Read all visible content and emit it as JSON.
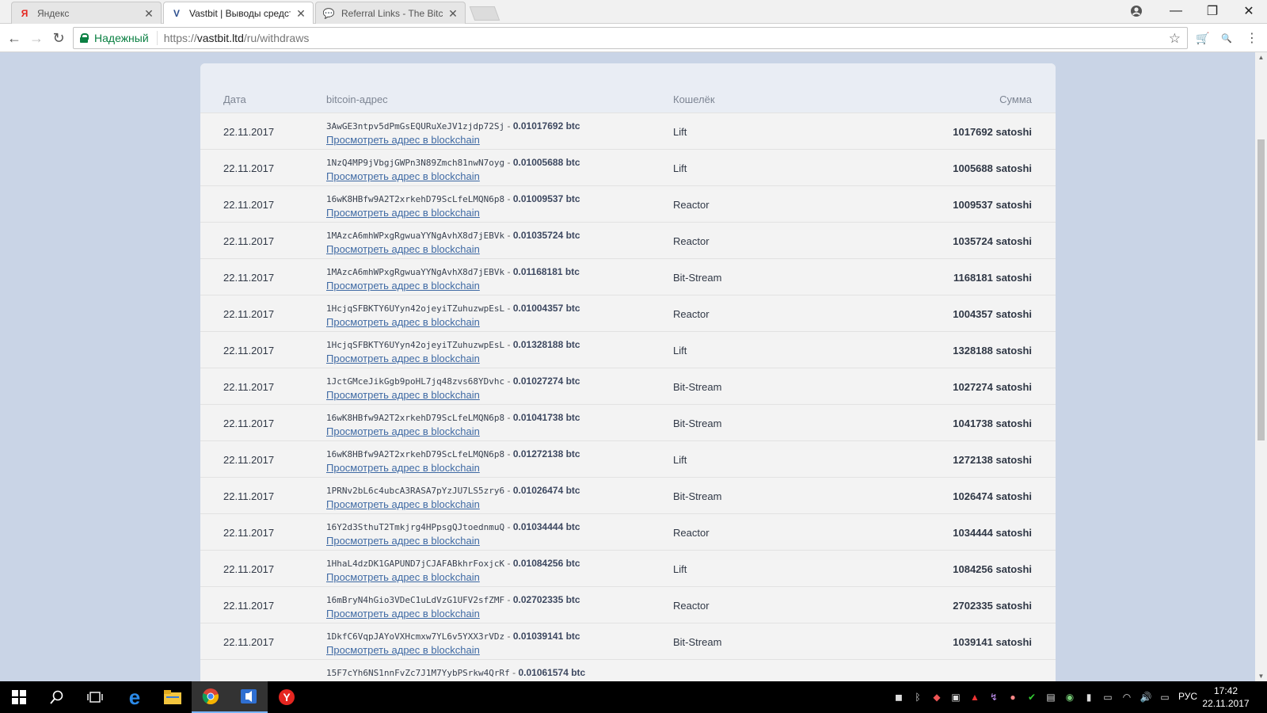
{
  "browser": {
    "tabs": [
      {
        "favicon": "Я",
        "title": "Яндекс",
        "active": false
      },
      {
        "favicon": "V",
        "title": "Vastbit | Выводы средств",
        "active": true
      },
      {
        "favicon": "💬",
        "title": "Referral Links - The Bitco",
        "active": false
      }
    ],
    "secure_label": "Надежный",
    "url_scheme": "https://",
    "url_host": "vastbit.ltd",
    "url_path": "/ru/withdraws"
  },
  "table": {
    "headers": {
      "date": "Дата",
      "address": "bitcoin-адрес",
      "wallet": "Кошелёк",
      "sum": "Сумма"
    },
    "link_label": "Просмотреть адрес в blockchain",
    "rows": [
      {
        "date": "22.11.2017",
        "address": "3AwGE3ntpv5dPmGsEQURuXeJV1zjdp72Sj",
        "btc": "0.01017692 btc",
        "wallet": "Lift",
        "sum": "1017692 satoshi"
      },
      {
        "date": "22.11.2017",
        "address": "1NzQ4MP9jVbgjGWPn3N89Zmch81nwN7oyg",
        "btc": "0.01005688 btc",
        "wallet": "Lift",
        "sum": "1005688 satoshi"
      },
      {
        "date": "22.11.2017",
        "address": "16wK8HBfw9A2T2xrkehD79ScLfeLMQN6p8",
        "btc": "0.01009537 btc",
        "wallet": "Reactor",
        "sum": "1009537 satoshi"
      },
      {
        "date": "22.11.2017",
        "address": "1MAzcA6mhWPxgRgwuaYYNgAvhX8d7jEBVk",
        "btc": "0.01035724 btc",
        "wallet": "Reactor",
        "sum": "1035724 satoshi"
      },
      {
        "date": "22.11.2017",
        "address": "1MAzcA6mhWPxgRgwuaYYNgAvhX8d7jEBVk",
        "btc": "0.01168181 btc",
        "wallet": "Bit-Stream",
        "sum": "1168181 satoshi"
      },
      {
        "date": "22.11.2017",
        "address": "1HcjqSFBKTY6UYyn42ojeyiTZuhuzwpEsL",
        "btc": "0.01004357 btc",
        "wallet": "Reactor",
        "sum": "1004357 satoshi"
      },
      {
        "date": "22.11.2017",
        "address": "1HcjqSFBKTY6UYyn42ojeyiTZuhuzwpEsL",
        "btc": "0.01328188 btc",
        "wallet": "Lift",
        "sum": "1328188 satoshi"
      },
      {
        "date": "22.11.2017",
        "address": "1JctGMceJikGgb9poHL7jq48zvs68YDvhc",
        "btc": "0.01027274 btc",
        "wallet": "Bit-Stream",
        "sum": "1027274 satoshi"
      },
      {
        "date": "22.11.2017",
        "address": "16wK8HBfw9A2T2xrkehD79ScLfeLMQN6p8",
        "btc": "0.01041738 btc",
        "wallet": "Bit-Stream",
        "sum": "1041738 satoshi"
      },
      {
        "date": "22.11.2017",
        "address": "16wK8HBfw9A2T2xrkehD79ScLfeLMQN6p8",
        "btc": "0.01272138 btc",
        "wallet": "Lift",
        "sum": "1272138 satoshi"
      },
      {
        "date": "22.11.2017",
        "address": "1PRNv2bL6c4ubcA3RASA7pYzJU7LS5zry6",
        "btc": "0.01026474 btc",
        "wallet": "Bit-Stream",
        "sum": "1026474 satoshi"
      },
      {
        "date": "22.11.2017",
        "address": "16Y2d3SthuT2Tmkjrg4HPpsgQJtoednmuQ",
        "btc": "0.01034444 btc",
        "wallet": "Reactor",
        "sum": "1034444 satoshi"
      },
      {
        "date": "22.11.2017",
        "address": "1HhaL4dzDK1GAPUND7jCJAFABkhrFoxjcK",
        "btc": "0.01084256 btc",
        "wallet": "Lift",
        "sum": "1084256 satoshi"
      },
      {
        "date": "22.11.2017",
        "address": "16mBryN4hGio3VDeC1uLdVzG1UFV2sfZMF",
        "btc": "0.02702335 btc",
        "wallet": "Reactor",
        "sum": "2702335 satoshi"
      },
      {
        "date": "22.11.2017",
        "address": "1DkfC6VqpJAYoVXHcmxw7YL6v5YXX3rVDz",
        "btc": "0.01039141 btc",
        "wallet": "Bit-Stream",
        "sum": "1039141 satoshi"
      },
      {
        "date": "",
        "address": "15F7cYh6NS1nnFvZc7J1M7YybPSrkw4QrRf",
        "btc": "0.01061574 btc",
        "wallet": "",
        "sum": ""
      }
    ]
  },
  "taskbar": {
    "language": "РУС",
    "time": "17:42",
    "date": "22.11.2017"
  }
}
